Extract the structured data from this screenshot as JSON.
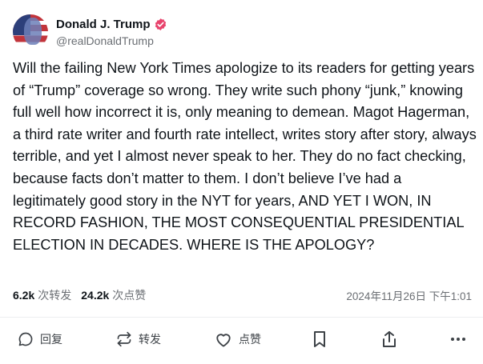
{
  "author": {
    "display_name": "Donald J. Trump",
    "handle": "@realDonaldTrump",
    "verified_color": "#e8436c"
  },
  "post": {
    "text": "Will the failing New York Times apologize to its readers for getting years of “Trump” coverage so wrong. They write such phony “junk,” knowing full well how incorrect it is, only meaning to demean. Magot Hagerman, a third rate writer and fourth rate intellect, writes story after story, always terrible, and yet I almost never speak to her. They do no fact checking, because facts don’t matter to them. I don’t believe I’ve had a legitimately good story in the NYT for years, AND YET I WON, IN RECORD FASHION, THE MOST CONSEQUENTIAL PRESIDENTIAL ELECTION IN DECADES. WHERE IS THE APOLOGY?"
  },
  "stats": {
    "reposts_count": "6.2k",
    "reposts_label": "次转发",
    "likes_count": "24.2k",
    "likes_label": "次点赞",
    "timestamp": "2024年11月26日 下午1:01"
  },
  "actions": {
    "reply_label": "回复",
    "repost_label": "转发",
    "like_label": "点赞"
  },
  "icons": {
    "reply": "reply-icon",
    "repost": "repost-icon",
    "like": "heart-icon",
    "bookmark": "bookmark-icon",
    "share": "share-icon",
    "more": "more-icon"
  }
}
